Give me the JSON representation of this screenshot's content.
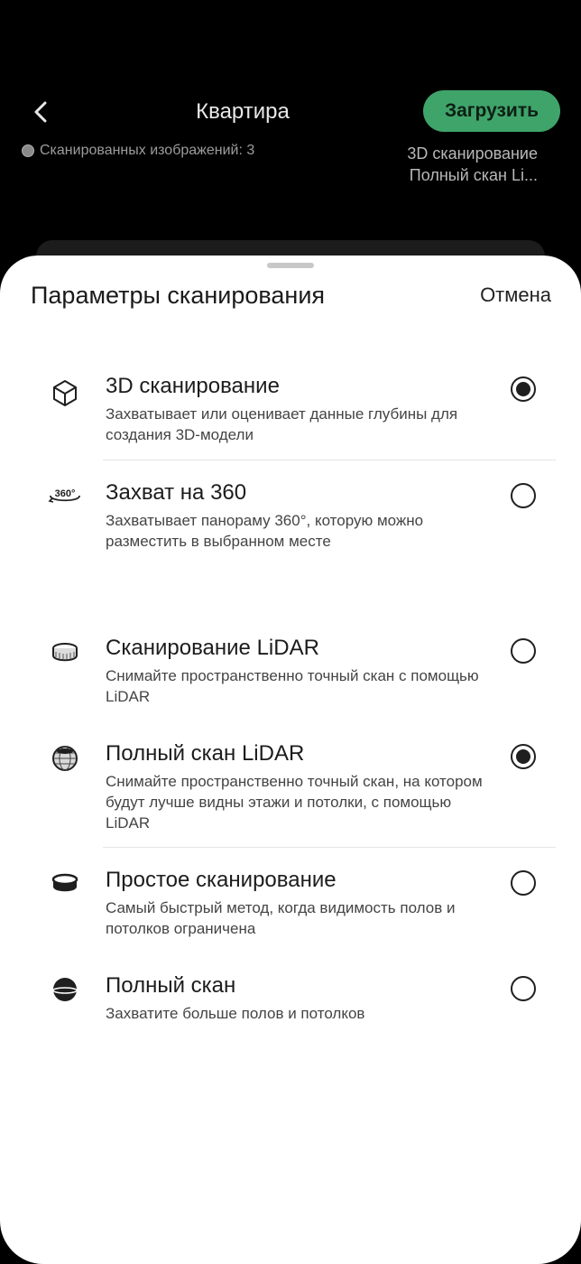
{
  "header": {
    "title": "Квартира",
    "upload_label": "Загрузить",
    "scan_count": "Сканированных изображений: 3",
    "mode_line1": "3D сканирование",
    "mode_line2": "Полный скан Li..."
  },
  "sheet": {
    "title": "Параметры сканирования",
    "cancel_label": "Отмена",
    "capture_options": [
      {
        "icon": "cube-icon",
        "title": "3D сканирование",
        "desc": "Захватывает или оценивает данные глубины для создания 3D-модели",
        "selected": true
      },
      {
        "icon": "360-icon",
        "title": "Захват на 360",
        "desc": "Захватывает панораму 360°, которую можно разместить в выбранном месте",
        "selected": false
      }
    ],
    "scan_modes": [
      {
        "icon": "lidar-ring-icon",
        "title": "Сканирование LiDAR",
        "desc": "Снимайте пространственно точный скан с помощью LiDAR",
        "selected": false
      },
      {
        "icon": "lidar-sphere-icon",
        "title": "Полный скан LiDAR",
        "desc": "Снимайте пространственно точный скан, на котором будут лучше видны этажи и потолки, с помощью LiDAR",
        "selected": true
      },
      {
        "icon": "simple-scan-icon",
        "title": "Простое сканирование",
        "desc": "Самый быстрый метод, когда видимость полов и потолков ограничена",
        "selected": false
      },
      {
        "icon": "full-scan-icon",
        "title": "Полный скан",
        "desc": "Захватите больше полов и потолков",
        "selected": false
      }
    ]
  }
}
